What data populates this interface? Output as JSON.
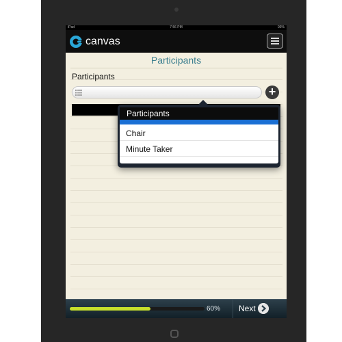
{
  "status_bar": {
    "carrier": "iPad",
    "time": "7:56 PM",
    "battery": "93%"
  },
  "app": {
    "name": "canvas",
    "logo_icon": "canvas-logo-icon",
    "menu_icon": "hamburger-menu-icon"
  },
  "page": {
    "title": "Participants",
    "field_label": "Participants",
    "add_icon": "plus-circle-icon",
    "list_icon": "list-icon"
  },
  "popover": {
    "header": "Participants",
    "items": [
      {
        "label": "Chair"
      },
      {
        "label": "Minute Taker"
      }
    ],
    "selected_index_color": "#1a6fd4"
  },
  "footer": {
    "progress": 0.6,
    "progress_text": "60%",
    "next_label": "Next",
    "next_icon": "chevron-right-circle-icon",
    "accent": "#c8e02b"
  }
}
